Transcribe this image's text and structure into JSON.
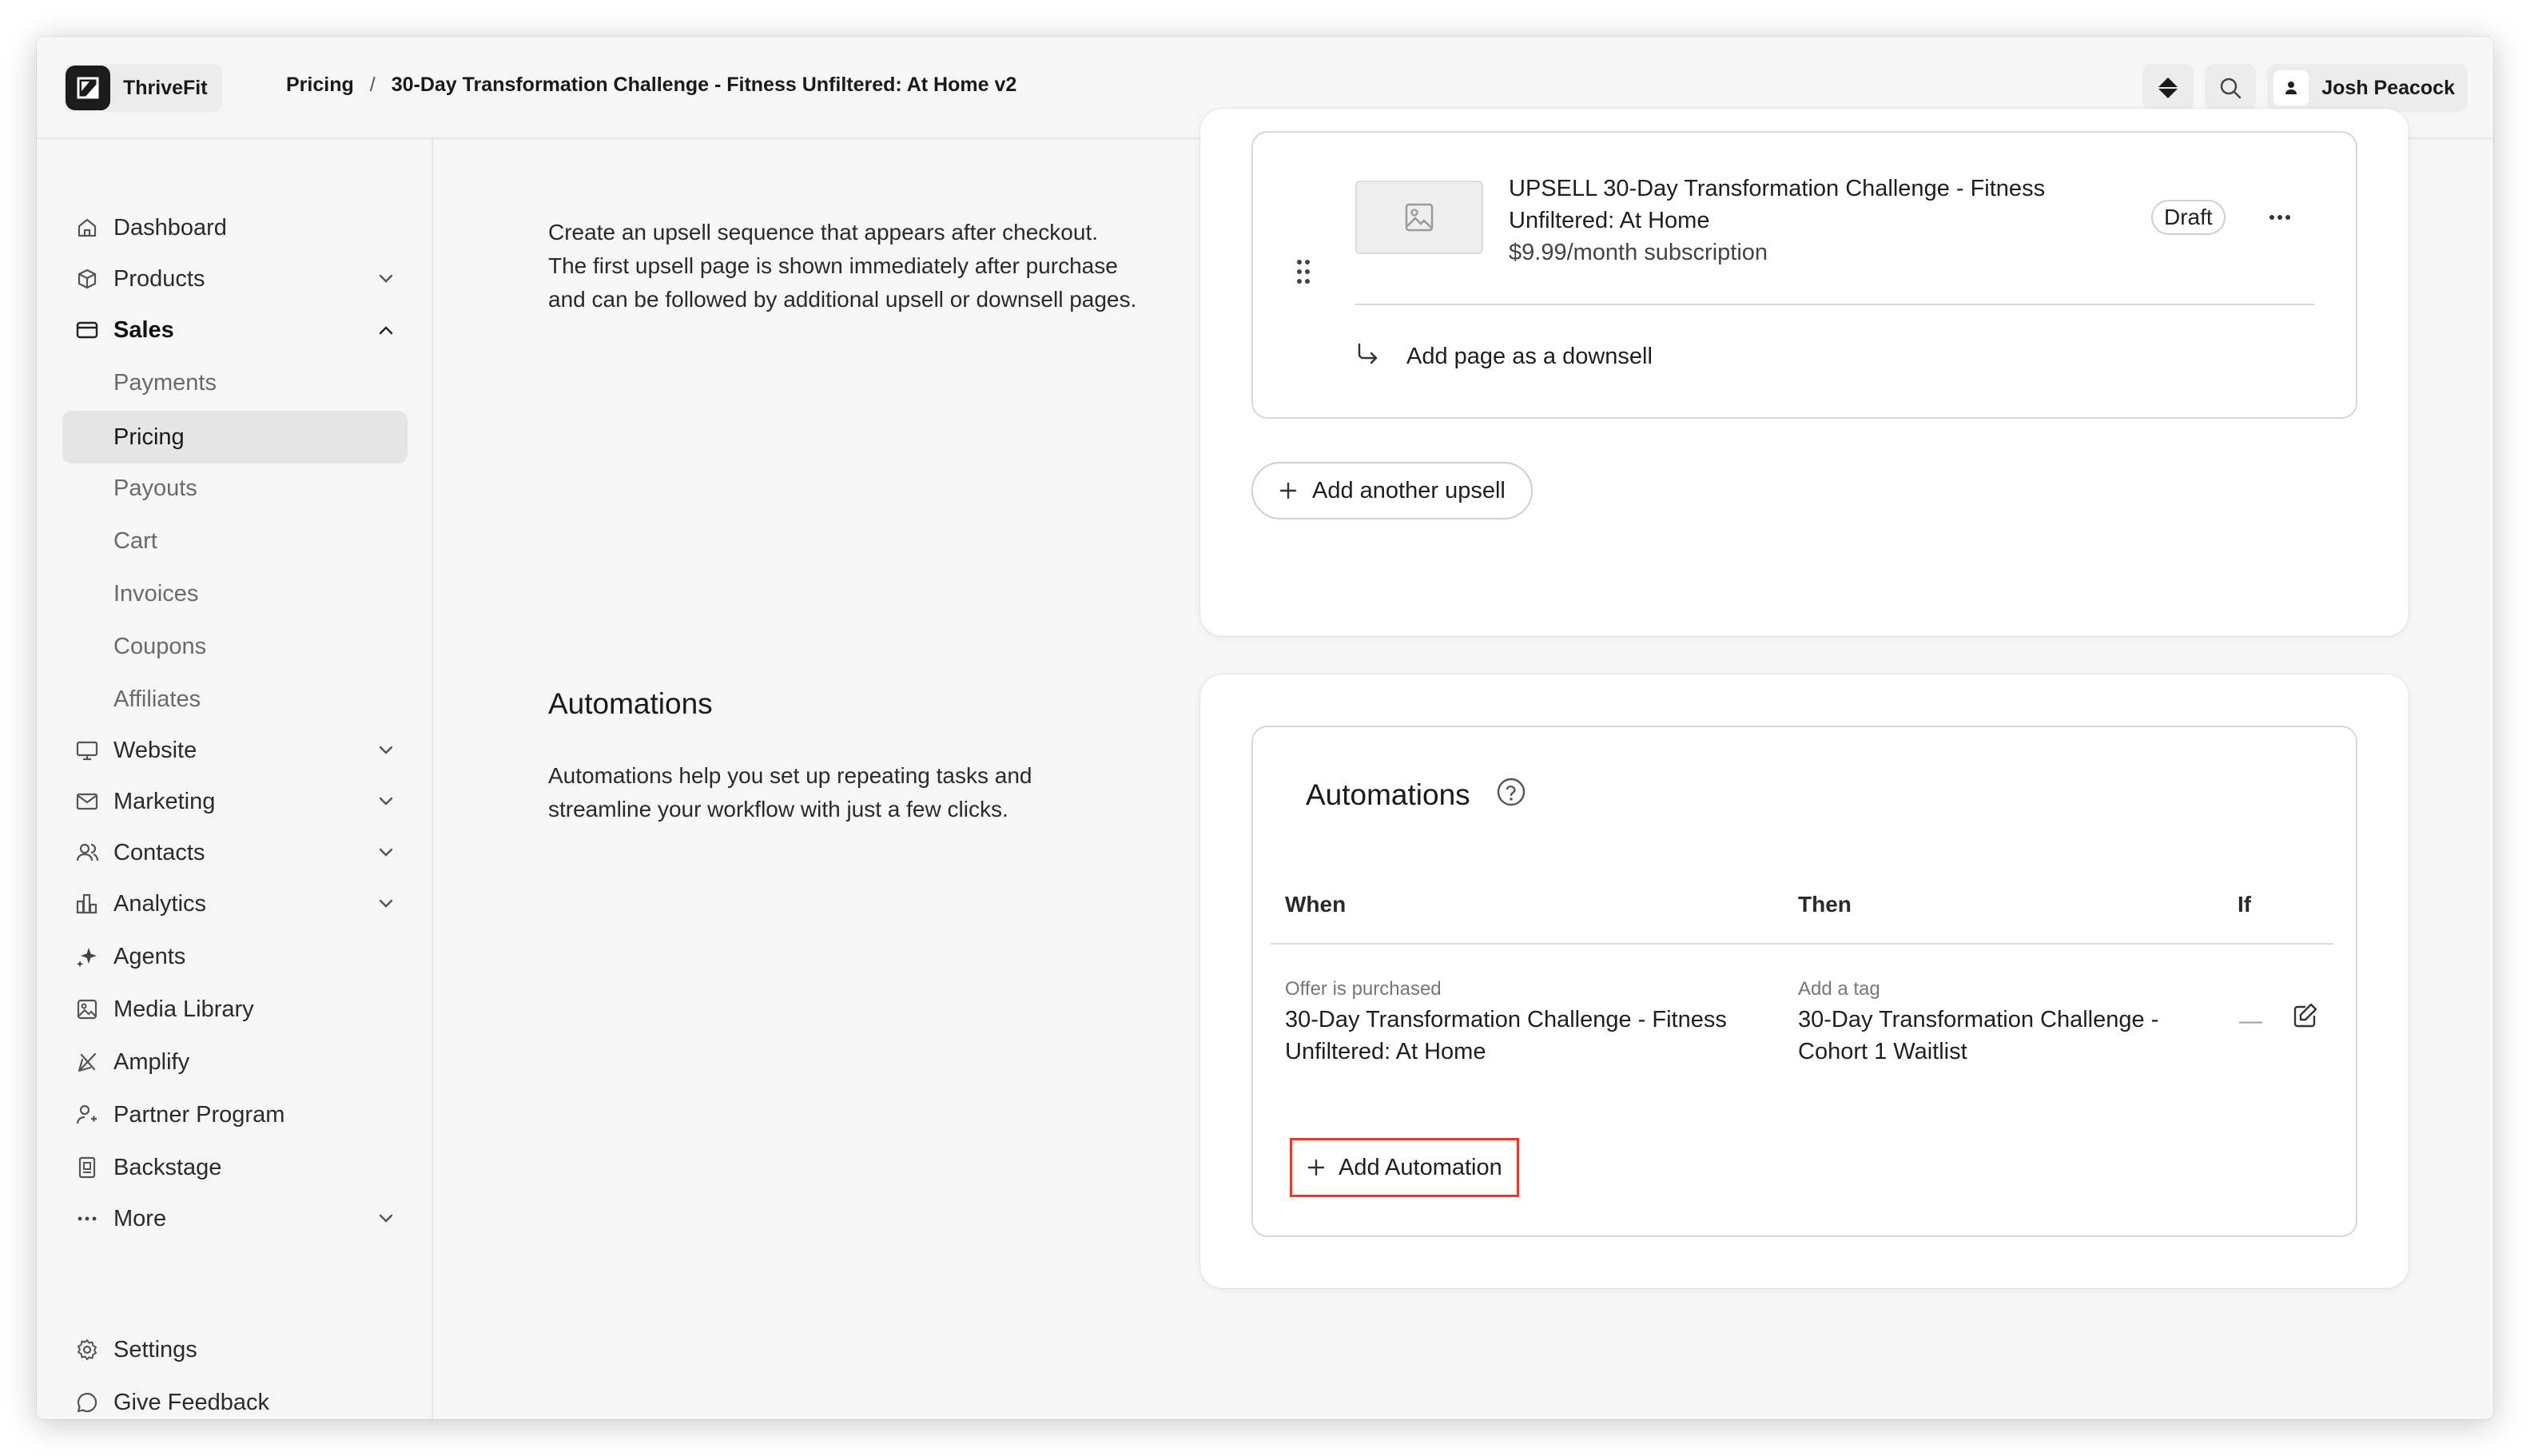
{
  "app": {
    "brand_name": "ThriveFit"
  },
  "breadcrumb": {
    "parent": "Pricing",
    "separator": "/",
    "current": "30-Day Transformation Challenge - Fitness Unfiltered: At Home v2"
  },
  "topbar": {
    "user_name": "Josh Peacock"
  },
  "sidebar": {
    "items": [
      {
        "label": "Dashboard",
        "icon": "home-icon"
      },
      {
        "label": "Products",
        "icon": "box-icon"
      },
      {
        "label": "Sales",
        "icon": "card-icon"
      },
      {
        "label": "Payments"
      },
      {
        "label": "Pricing"
      },
      {
        "label": "Payouts"
      },
      {
        "label": "Cart"
      },
      {
        "label": "Invoices"
      },
      {
        "label": "Coupons"
      },
      {
        "label": "Affiliates"
      },
      {
        "label": "Website",
        "icon": "monitor-icon"
      },
      {
        "label": "Marketing",
        "icon": "mail-icon"
      },
      {
        "label": "Contacts",
        "icon": "users-icon"
      },
      {
        "label": "Analytics",
        "icon": "bar-chart-icon"
      },
      {
        "label": "Agents",
        "icon": "sparkle-icon"
      },
      {
        "label": "Media Library",
        "icon": "image-icon"
      },
      {
        "label": "Amplify",
        "icon": "megaphone-icon"
      },
      {
        "label": "Partner Program",
        "icon": "partner-icon"
      },
      {
        "label": "Backstage",
        "icon": "backstage-icon"
      },
      {
        "label": "More",
        "icon": "dots-icon"
      }
    ],
    "footer": [
      {
        "label": "Settings",
        "icon": "gear-icon"
      },
      {
        "label": "Give Feedback",
        "icon": "chat-icon"
      }
    ]
  },
  "upsell_section": {
    "description": "Create an upsell sequence that appears after checkout. The first upsell page is shown immediately after purchase and can be followed by additional upsell or downsell pages.",
    "item_title": "UPSELL 30-Day Transformation Challenge - Fitness Unfiltered: At Home",
    "item_price": "$9.99/month subscription",
    "item_status": "Draft",
    "downsell_label": "Add page as a downsell",
    "add_upsell_label": "Add another upsell"
  },
  "automations_section": {
    "title": "Automations",
    "description": "Automations help you set up repeating tasks and streamline your workflow with just a few clicks.",
    "card_title": "Automations",
    "columns": [
      "When",
      "Then",
      "If"
    ],
    "rows": [
      {
        "when_label": "Offer is purchased",
        "when_value": "30-Day Transformation Challenge - Fitness Unfiltered: At Home",
        "then_label": "Add a tag",
        "then_value": "30-Day Transformation Challenge - Cohort 1 Waitlist",
        "if_value": "—"
      }
    ],
    "add_label": "Add Automation"
  },
  "colors": {
    "highlight": "#e5392b",
    "active_nav": "#e5e5e5"
  }
}
